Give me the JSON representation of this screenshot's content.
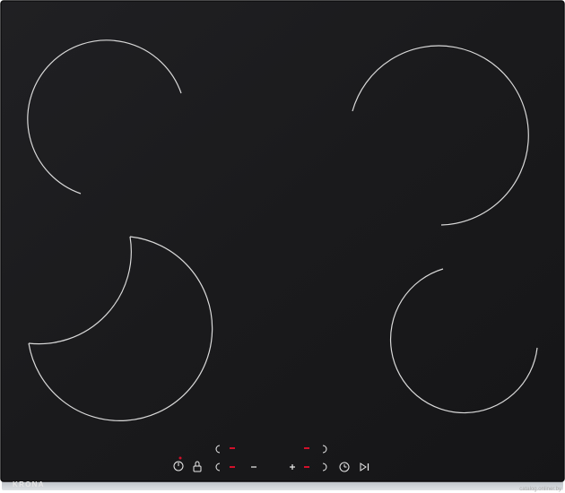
{
  "product": {
    "brand_label": "KRONA",
    "watermark_text": "catalog.onliner.by"
  },
  "colors": {
    "glass": "#1b1b1d",
    "glass_edge": "#0d0d0e",
    "frame": "#c9cdd1",
    "zone_ring": "#d7d7d7",
    "indicator_red": "#d1102a",
    "control_icon": "#eeeeee"
  },
  "controls": {
    "icons": [
      "power-icon",
      "lock-icon",
      "zone-selector-icon",
      "minus-icon",
      "plus-icon",
      "zone-selector-icon",
      "timer-icon",
      "play-pause-icon"
    ]
  }
}
